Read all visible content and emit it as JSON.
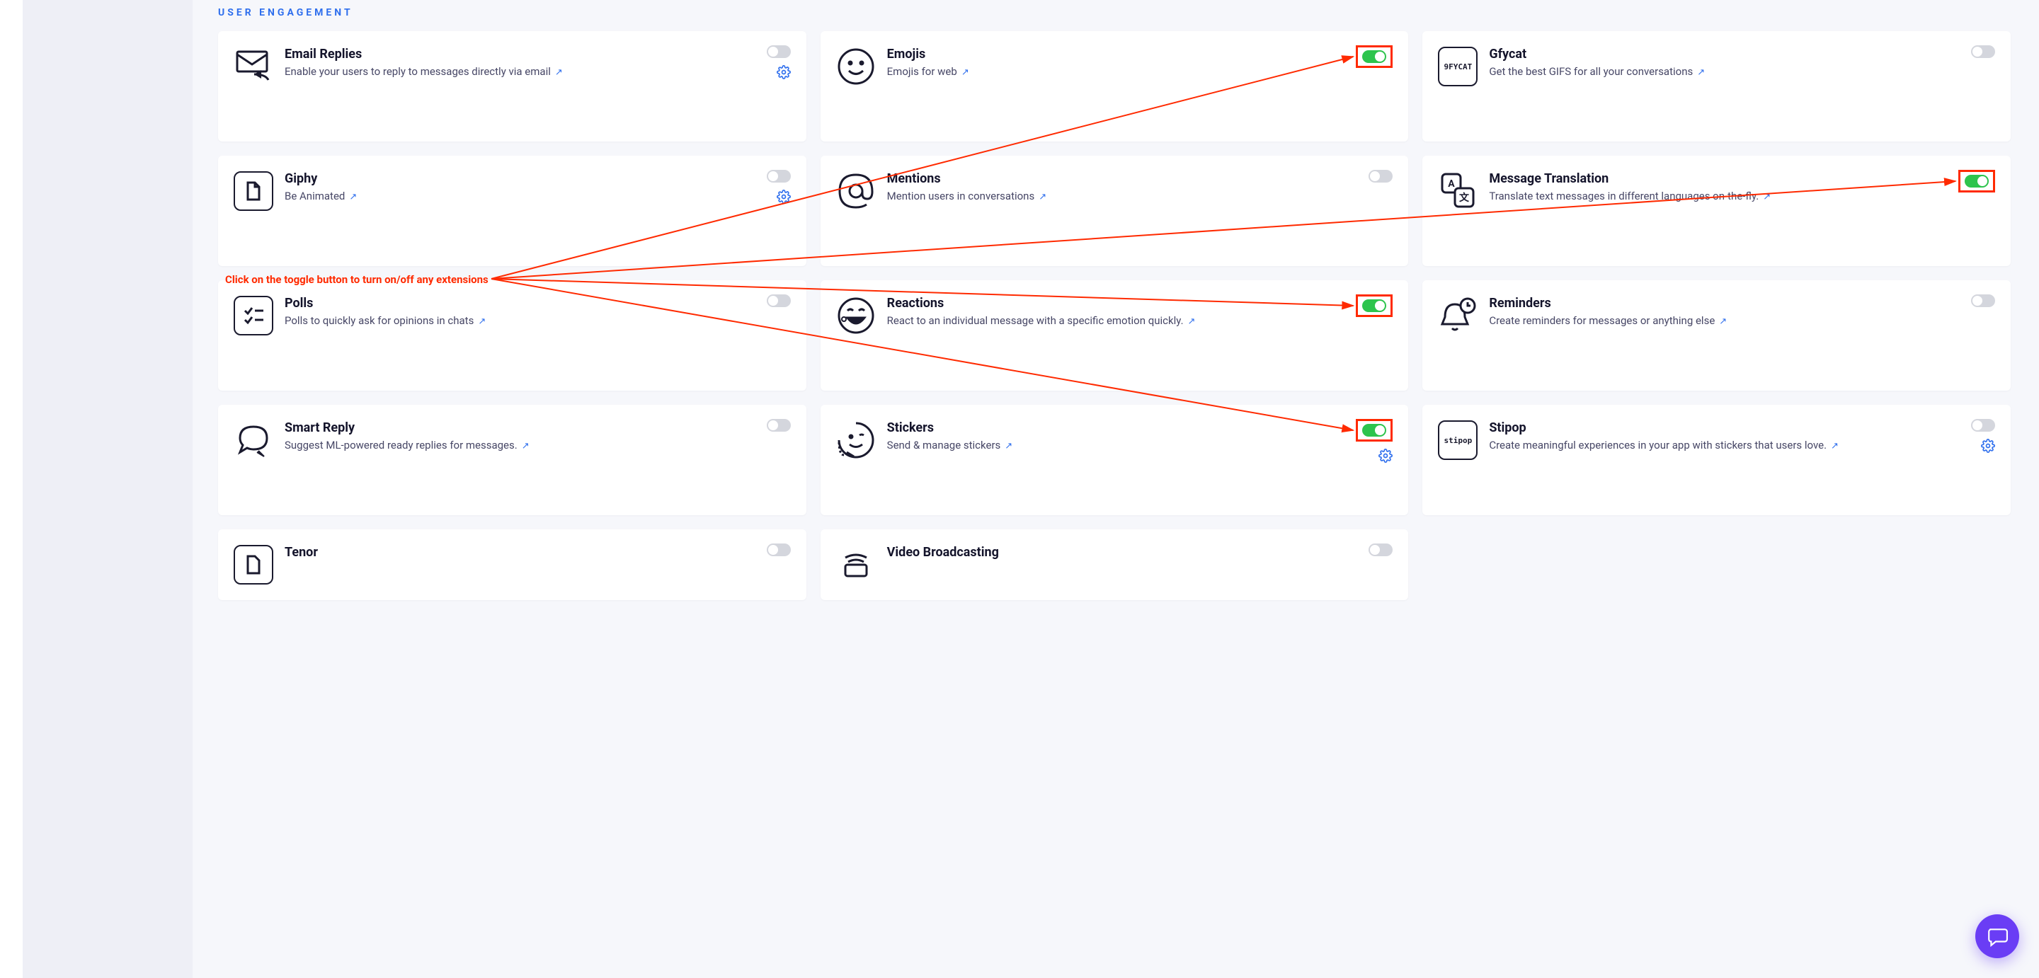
{
  "section_title": "USER ENGAGEMENT",
  "annotation_text": "Click on the toggle button to turn on/off any extensions",
  "cards": {
    "email_replies": {
      "title": "Email Replies",
      "desc": "Enable your users to reply to messages directly via email",
      "icon": "envelope-reply",
      "toggle": "off",
      "gear": true
    },
    "emojis": {
      "title": "Emojis",
      "desc": "Emojis for web",
      "icon": "smiley",
      "toggle": "on",
      "highlight": true
    },
    "gfycat": {
      "title": "Gfycat",
      "desc": "Get the best GIFS for all your conversations",
      "icon": "gfycat-logo",
      "toggle": "off"
    },
    "giphy": {
      "title": "Giphy",
      "desc": "Be Animated",
      "icon": "file",
      "toggle": "off",
      "gear": true
    },
    "mentions": {
      "title": "Mentions",
      "desc": "Mention users in conversations",
      "icon": "at-sign",
      "toggle": "off"
    },
    "message_translation": {
      "title": "Message Translation",
      "desc": "Translate text messages in different languages on-the-fly.",
      "icon": "translate",
      "toggle": "on",
      "highlight": true
    },
    "polls": {
      "title": "Polls",
      "desc": "Polls to quickly ask for opinions in chats",
      "icon": "checklist",
      "toggle": "off"
    },
    "reactions": {
      "title": "Reactions",
      "desc": "React to an individual message with a specific emotion quickly.",
      "icon": "laugh",
      "toggle": "on",
      "highlight": true
    },
    "reminders": {
      "title": "Reminders",
      "desc": "Create reminders for messages or anything else",
      "icon": "bell-clock",
      "toggle": "off"
    },
    "smart_reply": {
      "title": "Smart Reply",
      "desc": "Suggest ML-powered ready replies for messages.",
      "icon": "chat-arrow",
      "toggle": "off"
    },
    "stickers": {
      "title": "Stickers",
      "desc": "Send & manage stickers",
      "icon": "wink-sticker",
      "toggle": "on",
      "highlight": true,
      "gear": true
    },
    "stipop": {
      "title": "Stipop",
      "desc": "Create meaningful experiences in your app with stickers that users love.",
      "icon": "stipop-logo",
      "toggle": "off",
      "gear": true
    },
    "tenor": {
      "title": "Tenor",
      "desc": "",
      "icon": "file",
      "toggle": "off"
    },
    "video_broadcasting": {
      "title": "Video Broadcasting",
      "desc": "",
      "icon": "broadcast",
      "toggle": "off"
    }
  }
}
